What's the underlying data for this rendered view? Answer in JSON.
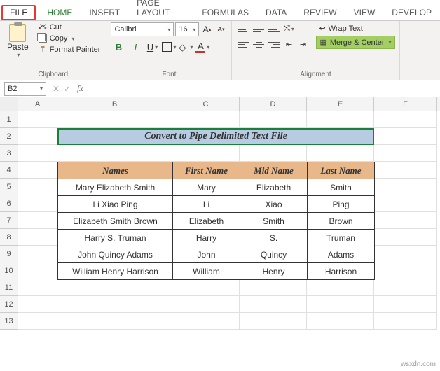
{
  "tabs": {
    "file": "FILE",
    "home": "HOME",
    "insert": "INSERT",
    "page_layout": "PAGE LAYOUT",
    "formulas": "FORMULAS",
    "data": "DATA",
    "review": "REVIEW",
    "view": "VIEW",
    "develop": "DEVELOP"
  },
  "ribbon": {
    "clipboard": {
      "paste": "Paste",
      "cut": "Cut",
      "copy": "Copy",
      "format_painter": "Format Painter",
      "group_label": "Clipboard"
    },
    "font": {
      "name": "Calibri",
      "size": "16",
      "incA": "A",
      "decA": "A",
      "B": "B",
      "I": "I",
      "U": "U",
      "A": "A",
      "group_label": "Font"
    },
    "alignment": {
      "wrap": "Wrap Text",
      "merge": "Merge & Center",
      "group_label": "Alignment"
    }
  },
  "fx": {
    "name_box": "B2",
    "cancel": "✕",
    "ok": "✓",
    "fx": "fx",
    "formula": ""
  },
  "columns": [
    "A",
    "B",
    "C",
    "D",
    "E",
    "F"
  ],
  "rows": [
    "1",
    "2",
    "3",
    "4",
    "5",
    "6",
    "7",
    "8",
    "9",
    "10",
    "11",
    "12",
    "13"
  ],
  "table": {
    "title": "Convert to Pipe Delimited Text File",
    "headers": [
      "Names",
      "First Name",
      "Mid Name",
      "Last Name"
    ],
    "data": [
      [
        "Mary Elizabeth Smith",
        "Mary",
        "Elizabeth",
        "Smith"
      ],
      [
        "Li Xiao Ping",
        "Li",
        "Xiao",
        "Ping"
      ],
      [
        "Elizabeth Smith Brown",
        "Elizabeth",
        "Smith",
        "Brown"
      ],
      [
        "Harry S. Truman",
        "Harry",
        "S.",
        "Truman"
      ],
      [
        "John Quincy Adams",
        "John",
        "Quincy",
        "Adams"
      ],
      [
        "William Henry Harrison",
        "William",
        "Henry",
        "Harrison"
      ]
    ]
  },
  "watermark": "wsxdn.com"
}
